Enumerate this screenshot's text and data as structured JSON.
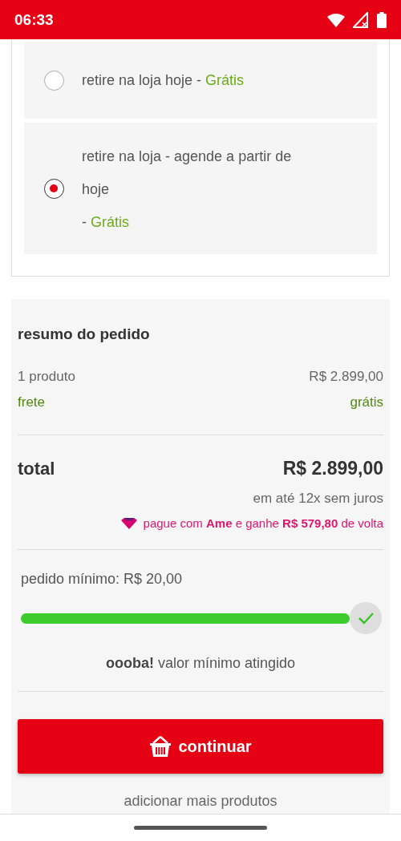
{
  "status_bar": {
    "time": "06:33"
  },
  "delivery_options": [
    {
      "kind": "inline",
      "label": "retire na loja hoje",
      "separator": "-",
      "price": "Grátis",
      "selected": false
    },
    {
      "kind": "stacked",
      "label": "retire na loja - agende a partir de hoje",
      "separator": "-",
      "price": "Grátis",
      "selected": true
    }
  ],
  "summary": {
    "title": "resumo do pedido",
    "lines": [
      {
        "kind": "plain",
        "label": "1 produto",
        "value": "R$ 2.899,00"
      },
      {
        "kind": "free",
        "label": "frete",
        "value": "grátis"
      }
    ],
    "total_label": "total",
    "total_value": "R$ 2.899,00",
    "installments": "em até 12x sem juros",
    "cashback": "pague com **Ame** e ganhe **R$ 579,80** de volta",
    "minimum_label": "pedido mínimo: R$ 20,00",
    "minimum_progress": {
      "level": 1,
      "reached": true
    },
    "minimum_message": "**oooba!** valor mínimo atingido",
    "continue_button": "continuar",
    "add_more_link": "adicionar mais produtos"
  }
}
